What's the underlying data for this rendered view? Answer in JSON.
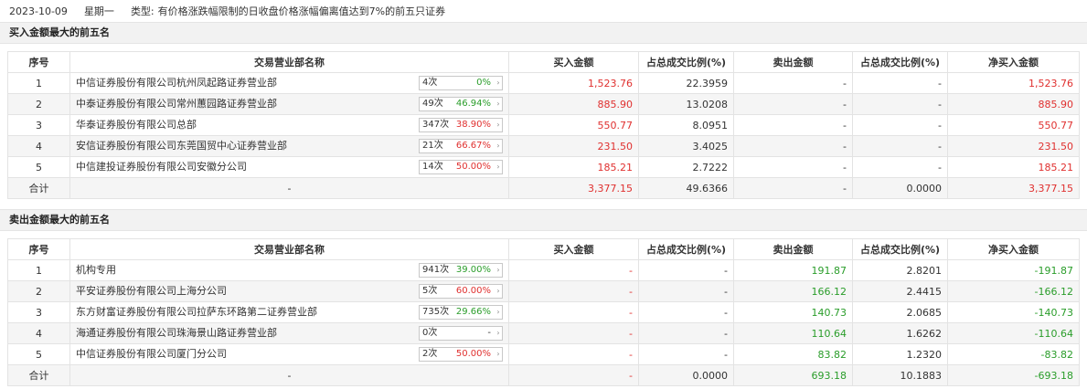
{
  "header": {
    "date": "2023-10-09",
    "weekday": "星期一",
    "type_label": "类型:",
    "type_text": "有价格涨跌幅限制的日收盘价格涨幅偏离值达到7%的前五只证券"
  },
  "columns": {
    "seq": "序号",
    "dept": "交易营业部名称",
    "buy": "买入金额",
    "buy_ratio": "占总成交比例(%)",
    "sell": "卖出金额",
    "sell_ratio": "占总成交比例(%)",
    "net": "净买入金额"
  },
  "buy_section": {
    "title": "买入金额最大的前五名",
    "rows": [
      {
        "seq": "1",
        "name": "中信证券股份有限公司杭州凤起路证券营业部",
        "times": "4次",
        "pct": "0%",
        "buy": "1,523.76",
        "buy_ratio": "22.3959",
        "sell": "-",
        "sell_ratio": "-",
        "net": "1,523.76"
      },
      {
        "seq": "2",
        "name": "中泰证券股份有限公司常州蕙园路证券营业部",
        "times": "49次",
        "pct": "46.94%",
        "buy": "885.90",
        "buy_ratio": "13.0208",
        "sell": "-",
        "sell_ratio": "-",
        "net": "885.90"
      },
      {
        "seq": "3",
        "name": "华泰证券股份有限公司总部",
        "times": "347次",
        "pct": "38.90%",
        "buy": "550.77",
        "buy_ratio": "8.0951",
        "sell": "-",
        "sell_ratio": "-",
        "net": "550.77"
      },
      {
        "seq": "4",
        "name": "安信证券股份有限公司东莞国贸中心证券营业部",
        "times": "21次",
        "pct": "66.67%",
        "buy": "231.50",
        "buy_ratio": "3.4025",
        "sell": "-",
        "sell_ratio": "-",
        "net": "231.50"
      },
      {
        "seq": "5",
        "name": "中信建投证券股份有限公司安徽分公司",
        "times": "14次",
        "pct": "50.00%",
        "buy": "185.21",
        "buy_ratio": "2.7222",
        "sell": "-",
        "sell_ratio": "-",
        "net": "185.21"
      }
    ],
    "total": {
      "label": "合计",
      "name": "-",
      "buy": "3,377.15",
      "buy_ratio": "49.6366",
      "sell": "-",
      "sell_ratio": "0.0000",
      "net": "3,377.15"
    }
  },
  "sell_section": {
    "title": "卖出金额最大的前五名",
    "rows": [
      {
        "seq": "1",
        "name": "机构专用",
        "times": "941次",
        "pct": "39.00%",
        "buy": "-",
        "buy_ratio": "-",
        "sell": "191.87",
        "sell_ratio": "2.8201",
        "net": "-191.87"
      },
      {
        "seq": "2",
        "name": "平安证券股份有限公司上海分公司",
        "times": "5次",
        "pct": "60.00%",
        "buy": "-",
        "buy_ratio": "-",
        "sell": "166.12",
        "sell_ratio": "2.4415",
        "net": "-166.12"
      },
      {
        "seq": "3",
        "name": "东方财富证券股份有限公司拉萨东环路第二证券营业部",
        "times": "735次",
        "pct": "29.66%",
        "buy": "-",
        "buy_ratio": "-",
        "sell": "140.73",
        "sell_ratio": "2.0685",
        "net": "-140.73"
      },
      {
        "seq": "4",
        "name": "海通证券股份有限公司珠海景山路证券营业部",
        "times": "0次",
        "pct": "-",
        "buy": "-",
        "buy_ratio": "-",
        "sell": "110.64",
        "sell_ratio": "1.6262",
        "net": "-110.64"
      },
      {
        "seq": "5",
        "name": "中信证券股份有限公司厦门分公司",
        "times": "2次",
        "pct": "50.00%",
        "buy": "-",
        "buy_ratio": "-",
        "sell": "83.82",
        "sell_ratio": "1.2320",
        "net": "-83.82"
      }
    ],
    "total": {
      "label": "合计",
      "name": "-",
      "buy": "-",
      "buy_ratio": "0.0000",
      "sell": "693.18",
      "sell_ratio": "10.1883",
      "net": "-693.18"
    }
  },
  "colors": {
    "positive": "#e0302f",
    "negative": "#2a9d2a"
  },
  "icons": {
    "count_arrow": "chevron-right-icon"
  }
}
